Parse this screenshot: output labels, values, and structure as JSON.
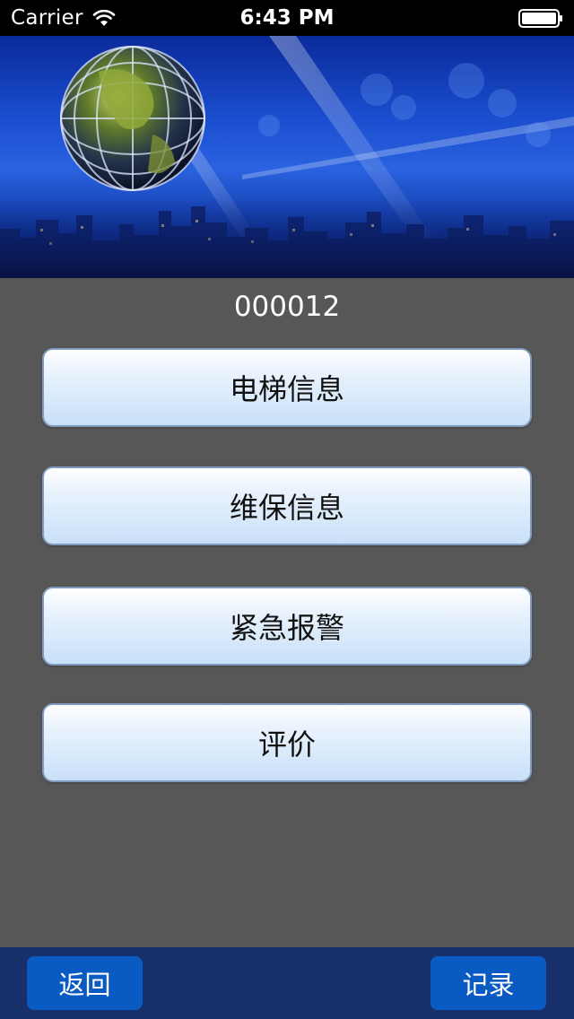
{
  "status_bar": {
    "carrier": "Carrier",
    "time": "6:43 PM"
  },
  "device_code": "000012",
  "menu": {
    "items": [
      {
        "label": "电梯信息"
      },
      {
        "label": "维保信息"
      },
      {
        "label": "紧急报警"
      },
      {
        "label": "评价"
      }
    ]
  },
  "toolbar": {
    "back_label": "返回",
    "records_label": "记录"
  },
  "colors": {
    "background": "#575757",
    "toolbar": "#17306a",
    "toolbar_button": "#0a5ac4",
    "menu_button_border": "#7f9cbf"
  },
  "icons": {
    "status": [
      "wifi-icon",
      "battery-icon"
    ],
    "banner": "globe-icon"
  }
}
